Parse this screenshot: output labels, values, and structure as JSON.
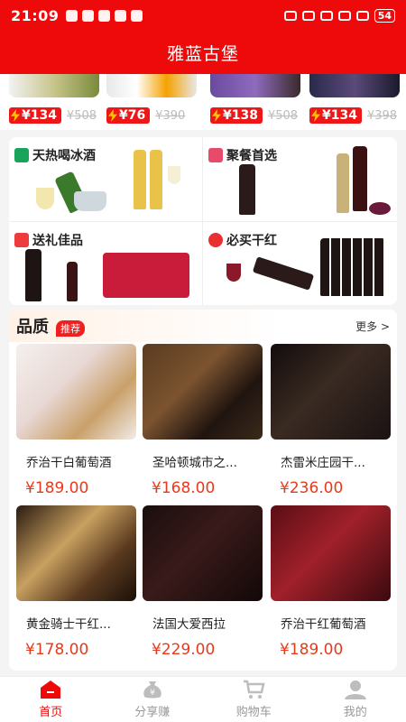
{
  "status_bar": {
    "time": "21:09",
    "battery": "54"
  },
  "header": {
    "title": "雅蓝古堡"
  },
  "flash_items": [
    {
      "price": "¥134",
      "old_price": "¥508"
    },
    {
      "price": "¥76",
      "old_price": "¥390"
    },
    {
      "price": "¥138",
      "old_price": "¥508"
    },
    {
      "price": "¥134",
      "old_price": "¥398"
    }
  ],
  "categories": [
    {
      "title": "天热喝冰酒",
      "icon": "palm-tree-icon"
    },
    {
      "title": "聚餐首选",
      "icon": "wine-glasses-icon"
    },
    {
      "title": "送礼佳品",
      "icon": "gift-icon"
    },
    {
      "title": "必买干红",
      "icon": "ribbon-icon"
    }
  ],
  "quality": {
    "title": "品质",
    "badge": "推荐",
    "more": "更多 >",
    "products": [
      {
        "name": "乔治干白葡萄酒",
        "price": "¥189.00"
      },
      {
        "name": "圣哈顿城市之...",
        "price": "¥168.00"
      },
      {
        "name": "杰雷米庄园干...",
        "price": "¥236.00"
      },
      {
        "name": "黄金骑士干红...",
        "price": "¥178.00"
      },
      {
        "name": "法国大爱西拉",
        "price": "¥229.00"
      },
      {
        "name": "乔治干红葡萄酒",
        "price": "¥189.00"
      }
    ]
  },
  "tabs": [
    {
      "label": "首页",
      "icon": "home-icon"
    },
    {
      "label": "分享赚",
      "icon": "money-bag-icon"
    },
    {
      "label": "购物车",
      "icon": "cart-icon"
    },
    {
      "label": "我的",
      "icon": "user-icon"
    }
  ],
  "colors": {
    "brand": "#ee0a0a",
    "price": "#e83a1a"
  }
}
